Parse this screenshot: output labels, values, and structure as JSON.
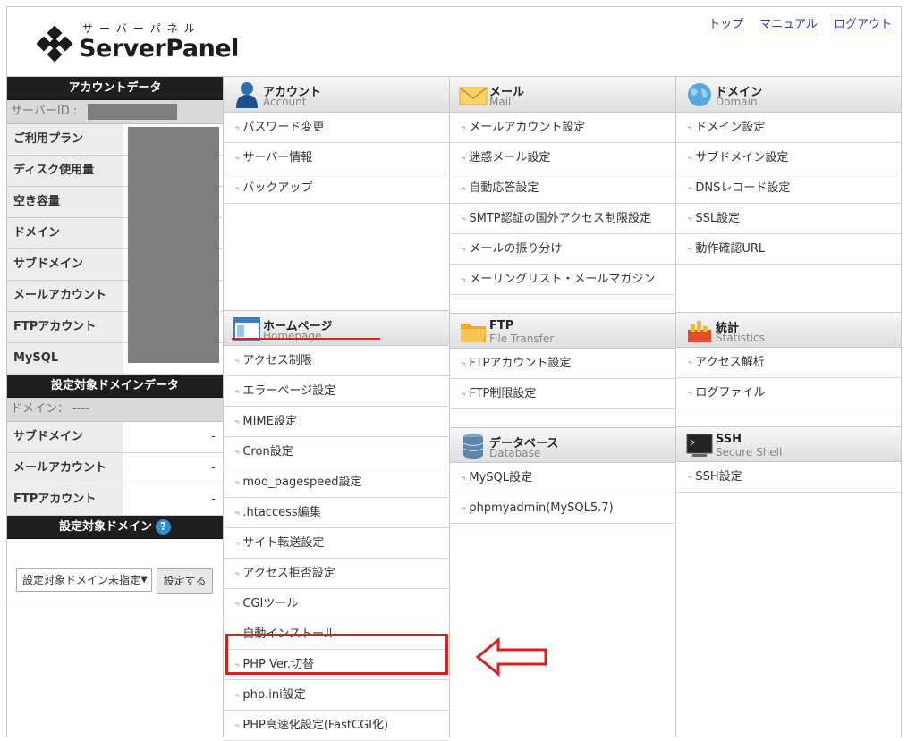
{
  "header": {
    "logo_kana": "サーバーパネル",
    "logo_text": "ServerPanel",
    "links": [
      "トップ",
      "マニュアル",
      "ログアウト"
    ]
  },
  "account": {
    "title": "アカウントデータ",
    "server_id_label": "サーバーID :",
    "rows": [
      "ご利用プラン",
      "ディスク使用量",
      "空き容量",
      "ドメイン",
      "サブドメイン",
      "メールアカウント",
      "FTPアカウント",
      "MySQL"
    ]
  },
  "domain_data": {
    "title": "設定対象ドメインデータ",
    "domain_label": "ドメイン： ----",
    "rows": [
      {
        "label": "サブドメイン",
        "value": "-"
      },
      {
        "label": "メールアカウント",
        "value": "-"
      },
      {
        "label": "FTPアカウント",
        "value": "-"
      }
    ]
  },
  "target_domain": {
    "title": "設定対象ドメイン",
    "help": "?",
    "select_value": "設定対象ドメイン未指定",
    "button": "設定する"
  },
  "menu": {
    "account": {
      "jp": "アカウント",
      "en": "Account",
      "items": [
        "パスワード変更",
        "サーバー情報",
        "バックアップ"
      ]
    },
    "mail": {
      "jp": "メール",
      "en": "Mail",
      "items": [
        "メールアカウント設定",
        "迷惑メール設定",
        "自動応答設定",
        "SMTP認証の国外アクセス制限設定",
        "メールの振り分け",
        "メーリングリスト・メールマガジン"
      ]
    },
    "domain": {
      "jp": "ドメイン",
      "en": "Domain",
      "items": [
        "ドメイン設定",
        "サブドメイン設定",
        "DNSレコード設定",
        "SSL設定",
        "動作確認URL"
      ]
    },
    "homepage": {
      "jp": "ホームページ",
      "en": "Homepage",
      "items": [
        "アクセス制限",
        "エラーページ設定",
        "MIME設定",
        "Cron設定",
        "mod_pagespeed設定",
        ".htaccess編集",
        "サイト転送設定",
        "アクセス拒否設定",
        "CGIツール",
        "自動インストール",
        "PHP Ver.切替",
        "php.ini設定",
        "PHP高速化設定(FastCGI化)"
      ]
    },
    "ftp": {
      "jp": "FTP",
      "en": "File Transfer",
      "items": [
        "FTPアカウント設定",
        "FTP制限設定"
      ]
    },
    "stats": {
      "jp": "統計",
      "en": "Statistics",
      "items": [
        "アクセス解析",
        "ログファイル"
      ]
    },
    "database": {
      "jp": "データベース",
      "en": "Database",
      "items": [
        "MySQL設定",
        "phpmyadmin(MySQL5.7)"
      ]
    },
    "ssh": {
      "jp": "SSH",
      "en": "Secure Shell",
      "items": [
        "SSH設定"
      ]
    }
  },
  "colors": {
    "highlight": "#d81e1e",
    "header_dark": "#1e1e1e"
  }
}
